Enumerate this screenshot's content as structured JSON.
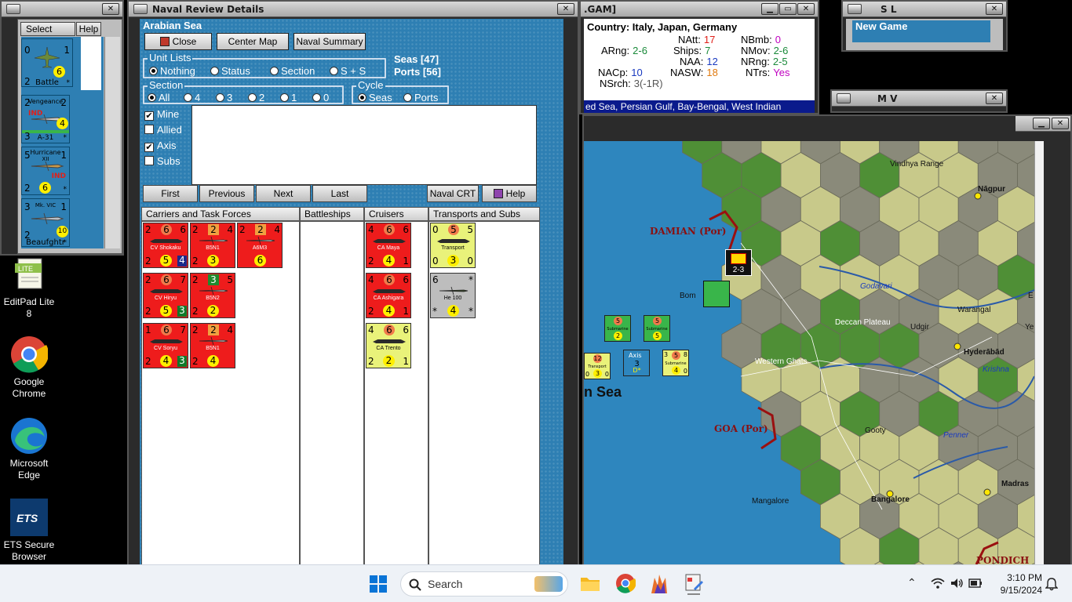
{
  "desktop": {
    "icons": [
      {
        "label": "EditPad Lite 8",
        "icon": "editpad-icon"
      },
      {
        "label": "Google Chrome",
        "icon": "chrome-icon"
      },
      {
        "label": "Microsoft Edge",
        "icon": "edge-icon"
      },
      {
        "label": "ETS Secure Browser",
        "icon": "ets-icon"
      }
    ]
  },
  "unit_panel": {
    "select_label": "Select",
    "help_label": "Help",
    "units": [
      {
        "tl": "0",
        "tr": "1",
        "bl": "2",
        "br": "*",
        "name": "Battle",
        "badge": "6"
      },
      {
        "tl": "2",
        "tr": "2",
        "bl": "3",
        "br": "*",
        "name": "A-31",
        "top": "Vengeance",
        "nation": "IND",
        "badge": "4"
      },
      {
        "tl": "5",
        "tr": "1",
        "bl": "2",
        "br": "*",
        "name": "Hurricane",
        "sub": "XII",
        "nation": "IND",
        "badge": "6"
      },
      {
        "tl": "3",
        "tr": "1",
        "bl": "2",
        "br": "*",
        "name": "Beaufghtr",
        "top": "Mk. VIC",
        "badge": "10"
      }
    ]
  },
  "naval_window": {
    "title": "Naval Review Details",
    "sea_name": "Arabian Sea",
    "buttons": {
      "close": "Close",
      "center_map": "Center Map",
      "naval_summary": "Naval Summary"
    },
    "seas_count": "Seas [47]",
    "ports_count": "Ports [56]",
    "unit_lists": {
      "label": "Unit Lists",
      "options": [
        "Nothing",
        "Status",
        "Section",
        "S + S"
      ],
      "selected": "Nothing"
    },
    "section": {
      "label": "Section",
      "options": [
        "All",
        "4",
        "3",
        "2",
        "1",
        "0"
      ],
      "selected": "All"
    },
    "cycle": {
      "label": "Cycle",
      "options": [
        "Seas",
        "Ports"
      ],
      "selected": "Seas"
    },
    "filters": [
      {
        "label": "Mine",
        "checked": true
      },
      {
        "label": "Allied",
        "checked": false
      },
      {
        "label": "Axis",
        "checked": true
      },
      {
        "label": "Subs",
        "checked": false
      }
    ],
    "nav": {
      "first": "First",
      "previous": "Previous",
      "next": "Next",
      "last": "Last",
      "naval_crt": "Naval CRT",
      "help": "Help"
    },
    "columns": [
      "Carriers and Task Forces",
      "Battleships",
      "Cruisers",
      "Transports and Subs"
    ],
    "carriers": [
      {
        "color": "red",
        "kind": "ship",
        "tl": "2",
        "tm": "6",
        "tr": "6",
        "name": "CV Shokaku",
        "bl": "2",
        "bm": "5",
        "br": "4",
        "br_style": "sq"
      },
      {
        "color": "red",
        "kind": "plane",
        "tl": "2",
        "tm": "2",
        "tr": "4",
        "name": "B5N1",
        "bl": "2",
        "bm": "3",
        "br": "",
        "tm_style": "sq"
      },
      {
        "color": "red",
        "kind": "plane",
        "tl": "2",
        "tm": "2",
        "tr": "4",
        "name": "A6M3",
        "bl": "",
        "bm": "6",
        "br": "",
        "tm_style": "sq"
      },
      {
        "color": "red",
        "kind": "ship",
        "tl": "2",
        "tm": "6",
        "tr": "7",
        "name": "CV Hiryu",
        "bl": "2",
        "bm": "5",
        "br": "3",
        "br_style": "gsq"
      },
      {
        "color": "red",
        "kind": "plane",
        "tl": "2",
        "tm": "3",
        "tr": "5",
        "name": "B5N2",
        "bl": "2",
        "bm": "2",
        "br": "",
        "tm_style": "grsq"
      },
      {
        "color": "red",
        "kind": "ship",
        "tl": "1",
        "tm": "6",
        "tr": "7",
        "name": "CV Soryu",
        "bl": "2",
        "bm": "4",
        "br": "3",
        "br_style": "gsq"
      },
      {
        "color": "red",
        "kind": "plane",
        "tl": "2",
        "tm": "2",
        "tr": "4",
        "name": "B5N1",
        "bl": "2",
        "bm": "4",
        "br": "",
        "tm_style": "sq"
      }
    ],
    "cruisers": [
      {
        "color": "red",
        "kind": "ship",
        "tl": "4",
        "tm": "6",
        "tr": "6",
        "name": "CA Maya",
        "bl": "2",
        "bm": "4",
        "br": "1"
      },
      {
        "color": "red",
        "kind": "ship",
        "tl": "4",
        "tm": "6",
        "tr": "6",
        "name": "CA Ashigara",
        "bl": "2",
        "bm": "4",
        "br": "1"
      },
      {
        "color": "yel",
        "kind": "ship",
        "tl": "4",
        "tm": "6",
        "tr": "6",
        "name": "CA Trento",
        "bl": "2",
        "bm": "2",
        "br": "1"
      }
    ],
    "transports": [
      {
        "color": "yel",
        "kind": "ship",
        "tl": "0",
        "tm": "5",
        "tr": "5",
        "name": "Transport",
        "bl": "0",
        "bm": "3",
        "br": "0"
      },
      {
        "color": "gry",
        "kind": "plane",
        "tl": "6",
        "tm": "",
        "tr": "*",
        "name": "He 100",
        "bl": "*",
        "bm": "4",
        "br": "*"
      }
    ]
  },
  "info_window": {
    "title": ".GAM]",
    "country": "Country: Italy, Japan, Germany",
    "stats": [
      {
        "label": "NAtt:",
        "value": "17",
        "color": "#e0201a"
      },
      {
        "label": "NBmb:",
        "value": "0",
        "color": "#c000c0"
      },
      {
        "label": "ARng:",
        "value": "2-6",
        "color": "#1a8a3a"
      },
      {
        "label": "Ships:",
        "value": "7",
        "color": "#1a8a3a"
      },
      {
        "label": "NMov:",
        "value": "2-6",
        "color": "#1a8a3a"
      },
      {
        "label": "NAA:",
        "value": "12",
        "color": "#1a3ac0"
      },
      {
        "label": "NRng:",
        "value": "2-5",
        "color": "#1a8a3a"
      },
      {
        "label": "NACp:",
        "value": "10",
        "color": "#1a3ac0"
      },
      {
        "label": "NASW:",
        "value": "18",
        "color": "#e07a10"
      },
      {
        "label": "NTrs:",
        "value": "Yes",
        "color": "#c000c0"
      },
      {
        "label": "NSrch:",
        "value": "3(-1R)",
        "color": "#555555"
      }
    ],
    "seas_line": "ed Sea, Persian Gulf, Bay-Bengal, West Indian"
  },
  "sl_window": {
    "title": "S L",
    "new_game": "New Game"
  },
  "mv_window": {
    "title": "M V"
  },
  "map": {
    "labels": {
      "vindhya": "Vindhya Range",
      "nagpur": "Nāgpur",
      "damian": "DAMIAN (Por)",
      "bom": "Bom",
      "godavari": "Godavari",
      "warangal": "Warangal",
      "deccan": "Deccan Plateau",
      "udgir": "Udgir",
      "hyderabad": "Hyderābād",
      "western_ghats": "Western Ghats",
      "krishna": "Krishna",
      "sea": "n Sea",
      "goa": "GOA (Por)",
      "gooty": "Gooty",
      "penner": "Penner",
      "mangalore": "Mangalore",
      "bangalore": "Bangalore",
      "madras": "Madras",
      "pondich": "PONDICH",
      "axis": "Axis",
      "stack": "2-3",
      "ye": "Ye",
      "e": "E"
    },
    "counters": [
      {
        "tl": "",
        "tm": "5",
        "tr": "",
        "bl": "",
        "bm": "2",
        "br": "",
        "label": "Submarine"
      },
      {
        "tl": "",
        "tm": "5",
        "tr": "",
        "bl": "",
        "bm": "5",
        "br": "",
        "label": "Submarine"
      },
      {
        "tl": "",
        "tm": "12",
        "tr": "",
        "bl": "0",
        "bm": "3",
        "br": "0",
        "label": "Transport"
      },
      {
        "tl": "",
        "tm": "3",
        "tr": "",
        "bl": "",
        "bm": "D*",
        "br": "",
        "label": ""
      },
      {
        "tl": "3",
        "tm": "5",
        "tr": "8",
        "bl": "",
        "bm": "4",
        "br": "0",
        "label": "Submarine"
      }
    ]
  },
  "taskbar": {
    "search_placeholder": "Search",
    "time": "3:10 PM",
    "date": "9/15/2024"
  }
}
